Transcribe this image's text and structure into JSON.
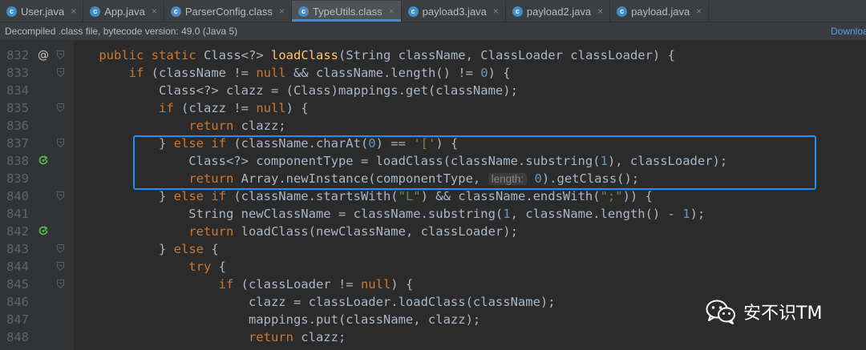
{
  "tabs": [
    {
      "label": "User.java",
      "icon": "c",
      "type": "java",
      "active": false
    },
    {
      "label": "App.java",
      "icon": "c",
      "type": "java",
      "active": false
    },
    {
      "label": "ParserConfig.class",
      "icon": "c",
      "type": "class",
      "active": false
    },
    {
      "label": "TypeUtils.class",
      "icon": "c",
      "type": "class",
      "active": true
    },
    {
      "label": "payload3.java",
      "icon": "c",
      "type": "java",
      "active": false
    },
    {
      "label": "payload2.java",
      "icon": "c",
      "type": "java",
      "active": false
    },
    {
      "label": "payload.java",
      "icon": "c",
      "type": "java",
      "active": false
    }
  ],
  "infobar": {
    "message": "Decompiled .class file, bytecode version: 49.0 (Java 5)",
    "download": "Downloa"
  },
  "editor": {
    "lines": [
      {
        "n": "832",
        "g": "at",
        "tokens": [
          {
            "t": "    "
          },
          {
            "t": "public",
            "c": "kw"
          },
          {
            "t": " "
          },
          {
            "t": "static",
            "c": "kw"
          },
          {
            "t": " Class<?> "
          },
          {
            "t": "loadClass",
            "c": "fn"
          },
          {
            "t": "(String className, ClassLoader classLoader) {"
          }
        ]
      },
      {
        "n": "833",
        "tokens": [
          {
            "t": "        "
          },
          {
            "t": "if",
            "c": "kw"
          },
          {
            "t": " (className != "
          },
          {
            "t": "null",
            "c": "kw"
          },
          {
            "t": " && className.length() != "
          },
          {
            "t": "0",
            "c": "num"
          },
          {
            "t": ") {"
          }
        ]
      },
      {
        "n": "834",
        "tokens": [
          {
            "t": "            Class<?> clazz = (Class)mappings.get(className);"
          }
        ]
      },
      {
        "n": "835",
        "tokens": [
          {
            "t": "            "
          },
          {
            "t": "if",
            "c": "kw"
          },
          {
            "t": " (clazz != "
          },
          {
            "t": "null",
            "c": "kw"
          },
          {
            "t": ") {"
          }
        ]
      },
      {
        "n": "836",
        "tokens": [
          {
            "t": "                "
          },
          {
            "t": "return",
            "c": "kw"
          },
          {
            "t": " clazz;"
          }
        ]
      },
      {
        "n": "837",
        "tokens": [
          {
            "t": "            } "
          },
          {
            "t": "else if",
            "c": "kw"
          },
          {
            "t": " (className.charAt("
          },
          {
            "t": "0",
            "c": "num"
          },
          {
            "t": ") == "
          },
          {
            "t": "'['",
            "c": "str"
          },
          {
            "t": ") {"
          }
        ]
      },
      {
        "n": "838",
        "g": "recurse",
        "tokens": [
          {
            "t": "                Class<?> componentType = loadClass(className.substring("
          },
          {
            "t": "1",
            "c": "num"
          },
          {
            "t": "), classLoader);"
          }
        ]
      },
      {
        "n": "839",
        "tokens": [
          {
            "t": "                "
          },
          {
            "t": "return",
            "c": "kw"
          },
          {
            "t": " Array.newInstance(componentType, "
          },
          {
            "t": "length:",
            "c": "hint"
          },
          {
            "t": " "
          },
          {
            "t": "0",
            "c": "num"
          },
          {
            "t": ").getClass();"
          }
        ]
      },
      {
        "n": "840",
        "tokens": [
          {
            "t": "            } "
          },
          {
            "t": "else if",
            "c": "kw"
          },
          {
            "t": " (className.startsWith("
          },
          {
            "t": "\"L\"",
            "c": "str"
          },
          {
            "t": ") && className.endsWith("
          },
          {
            "t": "\";\"",
            "c": "str"
          },
          {
            "t": ")) {"
          }
        ]
      },
      {
        "n": "841",
        "tokens": [
          {
            "t": "                String newClassName = className.substring("
          },
          {
            "t": "1",
            "c": "num"
          },
          {
            "t": ", className.length() - "
          },
          {
            "t": "1",
            "c": "num"
          },
          {
            "t": ");"
          }
        ]
      },
      {
        "n": "842",
        "g": "recurse",
        "tokens": [
          {
            "t": "                "
          },
          {
            "t": "return",
            "c": "kw"
          },
          {
            "t": " loadClass(newClassName, classLoader);"
          }
        ]
      },
      {
        "n": "843",
        "tokens": [
          {
            "t": "            } "
          },
          {
            "t": "else",
            "c": "kw"
          },
          {
            "t": " {"
          }
        ]
      },
      {
        "n": "844",
        "tokens": [
          {
            "t": "                "
          },
          {
            "t": "try",
            "c": "kw"
          },
          {
            "t": " {"
          }
        ]
      },
      {
        "n": "845",
        "tokens": [
          {
            "t": "                    "
          },
          {
            "t": "if",
            "c": "kw"
          },
          {
            "t": " (classLoader != "
          },
          {
            "t": "null",
            "c": "kw"
          },
          {
            "t": ") {"
          }
        ]
      },
      {
        "n": "846",
        "tokens": [
          {
            "t": "                        clazz = classLoader.loadClass(className);"
          }
        ]
      },
      {
        "n": "847",
        "tokens": [
          {
            "t": "                        mappings.put(className, clazz);"
          }
        ]
      },
      {
        "n": "848",
        "tokens": [
          {
            "t": "                        "
          },
          {
            "t": "return",
            "c": "kw"
          },
          {
            "t": " clazz;"
          }
        ]
      }
    ]
  },
  "watermark": {
    "text": "安不识TM",
    "icon": "wechat-icon"
  },
  "colors": {
    "background": "#2b2b2b",
    "keyword": "#cc7832",
    "number": "#6897bb",
    "string": "#6a8759",
    "highlight": "#1e90ff"
  }
}
